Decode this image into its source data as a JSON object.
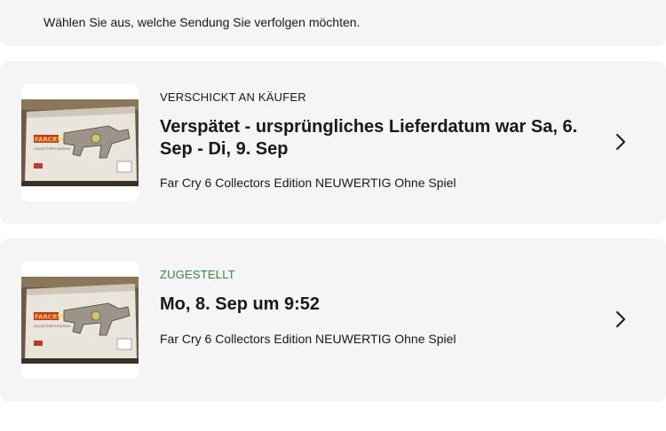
{
  "intro": {
    "text": "Wählen Sie aus, welche Sendung Sie verfolgen möchten."
  },
  "shipments": [
    {
      "status": "VERSCHICKT AN KÄUFER",
      "headline": "Verspätet - ursprüngliches Lieferdatum war Sa, 6. Sep - Di, 9. Sep",
      "item_title": "Far Cry 6 Collectors Edition NEUWERTIG Ohne Spiel",
      "icon": "chevron-right-icon"
    },
    {
      "status": "ZUGESTELLT",
      "headline": "Mo, 8. Sep um 9:52",
      "item_title": "Far Cry 6 Collectors Edition NEUWERTIG Ohne Spiel",
      "icon": "chevron-right-icon"
    }
  ],
  "product_box": {
    "logo": "FARCRY6",
    "edition": "COLLECTOR'S EDITION"
  },
  "colors": {
    "panel": "#f5f5f5",
    "delivered_status": "#2b8a3e",
    "text": "#191919"
  }
}
